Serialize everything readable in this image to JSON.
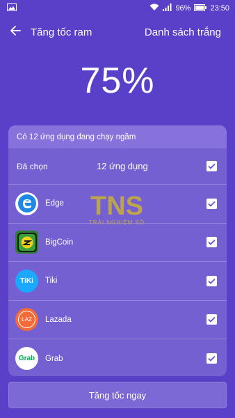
{
  "status_bar": {
    "battery_percent": "96%",
    "time": "23:50",
    "icons": [
      "image-icon",
      "wifi-icon",
      "signal-icon",
      "battery-icon"
    ]
  },
  "app_bar": {
    "back_icon": "arrow-left-icon",
    "title": "Tăng tốc ram",
    "whitelist_label": "Danh sách trắng"
  },
  "ram": {
    "percent_text": "75%"
  },
  "list": {
    "header": "Có 12 ứng dụng đang chạy ngầm",
    "selected_label": "Đã chọn",
    "selected_count": "12 ứng dụng",
    "apps": [
      {
        "name": "Edge",
        "icon": "edge-icon",
        "checked": true
      },
      {
        "name": "BigCoin",
        "icon": "bigcoin-icon",
        "checked": true
      },
      {
        "name": "Tiki",
        "icon": "tiki-icon",
        "checked": true,
        "icon_text": "TiKi"
      },
      {
        "name": "Lazada",
        "icon": "lazada-icon",
        "checked": true,
        "icon_text": "LAZ"
      },
      {
        "name": "Grab",
        "icon": "grab-icon",
        "checked": true,
        "icon_text": "Grab"
      }
    ]
  },
  "boost_button_label": "Tăng tốc ngay",
  "watermark": {
    "logo_text": "TNS",
    "tagline": "TRẢI NGHIỆM SỐ"
  },
  "colors": {
    "background": "#5a3fc8",
    "card": "#7560d2",
    "edge_blue": "#1e88e5",
    "bigcoin_green": "#2e7d32",
    "tiki_blue": "#1ba8ff",
    "lazada_orange": "#f26b38",
    "grab_green": "#00b14f",
    "watermark_gold": "#c9b037"
  }
}
